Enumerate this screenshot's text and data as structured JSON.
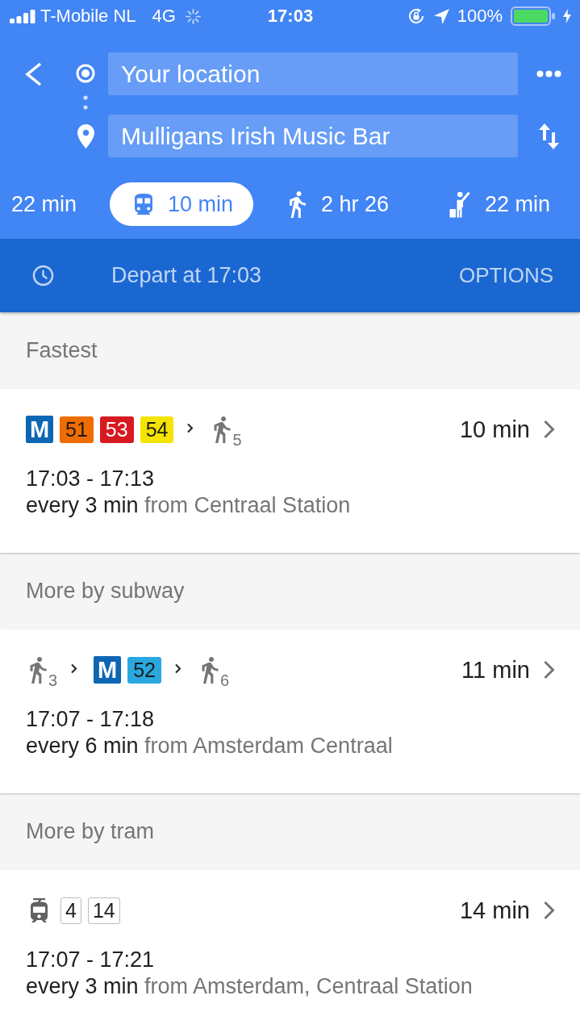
{
  "status_bar": {
    "carrier": "T-Mobile NL",
    "network": "4G",
    "time": "17:03",
    "battery": "100%"
  },
  "route_inputs": {
    "origin": {
      "value": "Your location"
    },
    "destination": {
      "value": "Mulligans Irish Music Bar"
    }
  },
  "modes": [
    {
      "kind": "plain",
      "label": "22 min",
      "selected": false
    },
    {
      "kind": "transit",
      "label": "10 min",
      "selected": true
    },
    {
      "kind": "walk",
      "label": "2 hr 26",
      "selected": false
    },
    {
      "kind": "hail",
      "label": "22 min",
      "selected": false
    }
  ],
  "departure": {
    "label": "Depart at 17:03",
    "options": "OPTIONS"
  },
  "sections": [
    {
      "title": "Fastest",
      "routes": [
        {
          "legs": [
            {
              "kind": "metro",
              "agency": "M",
              "lines": [
                {
                  "label": "51",
                  "color": "#ef6c00"
                },
                {
                  "label": "53",
                  "color": "#d71921"
                },
                {
                  "label": "54",
                  "color": "#f5e400"
                }
              ]
            },
            {
              "kind": "walk",
              "minutes": "5"
            }
          ],
          "duration": "10 min",
          "times": "17:03 - 17:13",
          "frequency": "every 3 min",
          "origin": "from Centraal Station"
        }
      ]
    },
    {
      "title": "More by subway",
      "routes": [
        {
          "legs": [
            {
              "kind": "walk",
              "minutes": "3"
            },
            {
              "kind": "metro",
              "agency": "M",
              "lines": [
                {
                  "label": "52",
                  "color": "#29a8e0"
                }
              ]
            },
            {
              "kind": "walk",
              "minutes": "6"
            }
          ],
          "duration": "11 min",
          "times": "17:07 - 17:18",
          "frequency": "every 6 min",
          "origin": "from Amsterdam Centraal"
        }
      ]
    },
    {
      "title": "More by tram",
      "routes": [
        {
          "legs": [
            {
              "kind": "tram",
              "lines": [
                {
                  "label": "4"
                },
                {
                  "label": "14"
                }
              ]
            }
          ],
          "duration": "14 min",
          "times": "17:07 - 17:21",
          "frequency": "every 3 min",
          "origin": "from Amsterdam, Centraal Station"
        }
      ]
    }
  ]
}
